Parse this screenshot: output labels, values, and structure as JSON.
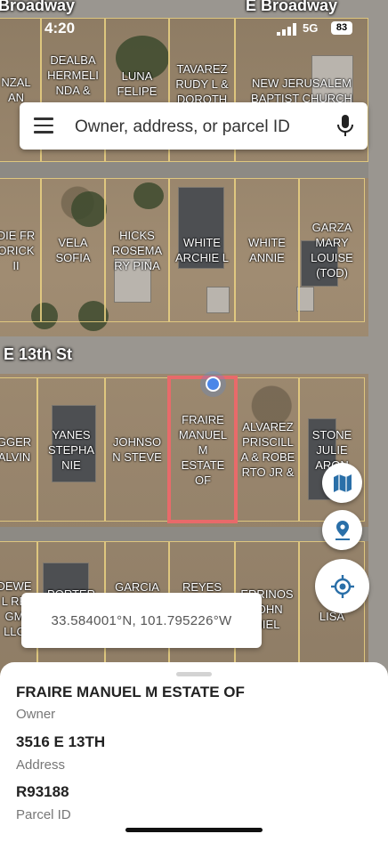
{
  "status_bar": {
    "time": "4:20",
    "network": "5G",
    "battery": "83"
  },
  "streets": {
    "top_left": "Broadway",
    "top_right": "E Broadway",
    "middle": "E 13th St"
  },
  "search": {
    "placeholder": "Owner, address, or parcel ID"
  },
  "parcels": {
    "row1": [
      "NZAL\nAN",
      "DEALBA\nHERMELI\nNDA &",
      "LUNA\nFELIPE",
      "TAVAREZ\nRUDY L &\nDOROTH",
      "NEW JERUSALEM\nBAPTIST CHURCH"
    ],
    "row2": [
      "DIE FR\nORICK\nII",
      "VELA\nSOFIA",
      "HICKS\nROSEMA\nRY PINA",
      "WHITE\nARCHIE L",
      "WHITE\nANNIE",
      "GARZA\nMARY\nLOUISE\n(TOD)"
    ],
    "row3": [
      "GGER\nALVIN",
      "YANES\nSTEPHA\nNIE",
      "JOHNSO\nN STEVE",
      "FRAIRE\nMANUEL\nM\nESTATE\nOF",
      "ALVAREZ\nPRISCILL\nA & ROBE\nRTO JR &",
      "STONE\nJULIE\nARON"
    ],
    "row4": [
      "DEWE\nL RE\nGM\nLLC",
      "PORTER",
      "GARCIA",
      "REYES",
      "ERRINOS\nJOHN\nNIEL",
      "PA\nLISA"
    ]
  },
  "coordinates": "33.584001°N, 101.795226°W",
  "detail": {
    "owner_value": "FRAIRE MANUEL M ESTATE OF",
    "owner_label": "Owner",
    "address_value": "3516 E 13TH",
    "address_label": "Address",
    "parcel_value": "R93188",
    "parcel_label": "Parcel ID"
  },
  "colors": {
    "highlight": "#e86a6a",
    "gps": "#4a86e8",
    "fab_icon": "#2a6fa8"
  },
  "icons": [
    "menu-icon",
    "microphone-icon",
    "map-icon",
    "location-pin-icon",
    "my-location-icon",
    "signal-icon"
  ]
}
